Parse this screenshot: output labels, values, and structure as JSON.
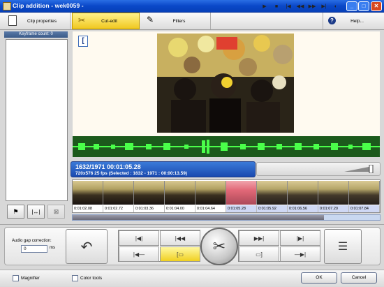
{
  "window": {
    "title": "Clip addition - wek0059 -"
  },
  "toolbar": {
    "clip_properties": "Clip properties",
    "cut_edit": "Cut-edit",
    "filters": "Filters",
    "help": "Help..."
  },
  "keyframes": {
    "header": "Keyframe count: 0"
  },
  "info": {
    "frame_time": "1632/1971  00:01:05.28",
    "details": "720x576 25  fps  (Selected : 1632 - 1971 : 00:00:13.59)"
  },
  "timeline": {
    "timecodes": [
      "0:01:02.08",
      "0:01:02.72",
      "0:01:03.36",
      "0:01:04.00",
      "0:01:04.64",
      "0:01:05.28",
      "0:01:05.92",
      "0:01:06.56",
      "0:01:07.20",
      "0:01:07.84"
    ]
  },
  "audio_gap": {
    "label": "Audio gap correction:",
    "value": "0",
    "unit": "ms"
  },
  "footer": {
    "magnifier": "Magnifier",
    "color_tools": "Color tools",
    "ok": "OK",
    "cancel": "Cancel"
  },
  "colors": {
    "accent": "#f0c820",
    "title_bar": "#0a48c8"
  }
}
